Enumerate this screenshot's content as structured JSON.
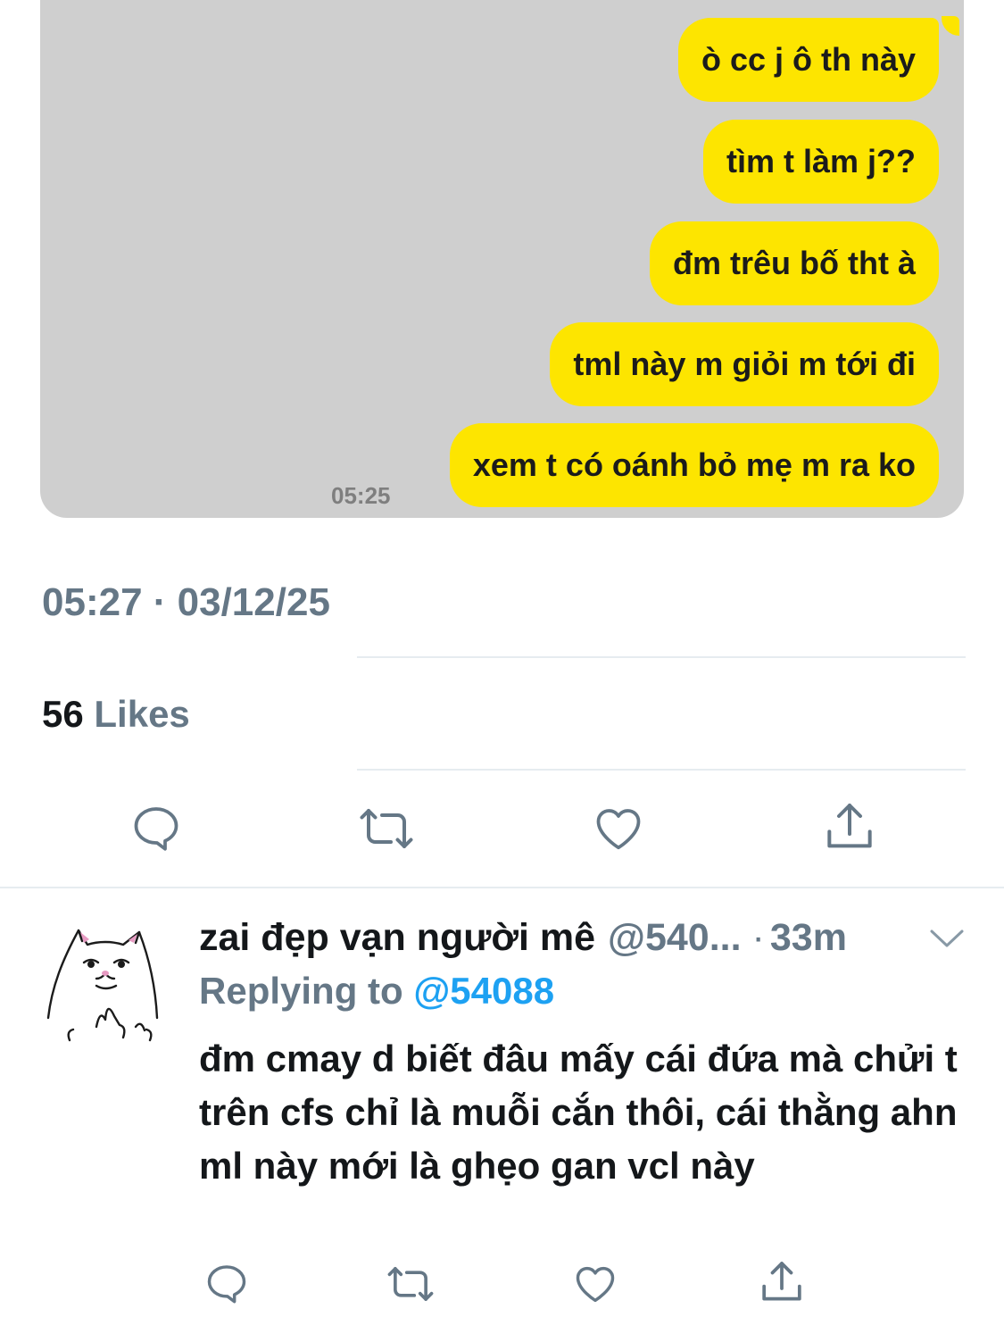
{
  "chat": {
    "bubbles": [
      "ò cc j ô th này",
      "tìm t làm j??",
      "đm trêu bố tht à",
      "tml này m giỏi m tới đi",
      "xem t có oánh bỏ mẹ m ra ko"
    ],
    "time": "05:25",
    "colors": {
      "background": "#cfcfcf",
      "bubble": "#fde500"
    }
  },
  "tweet": {
    "timestamp": "05:27 · 03/12/25",
    "likes_count": "56",
    "likes_label": "Likes",
    "actions": [
      "reply-icon",
      "retweet-icon",
      "like-icon",
      "share-icon"
    ]
  },
  "reply": {
    "display_name": "zai đẹp vạn người mê",
    "handle": "@540...",
    "dot": "·",
    "age": "33m",
    "replying_prefix": "Replying to",
    "replying_to": "@54088",
    "text": "đm cmay d biết đâu mấy cái đứa mà chửi t trên cfs chỉ là muỗi cắn thôi, cái thằng ahn ml này mới là ghẹo gan vcl này",
    "actions": [
      "reply-icon",
      "retweet-icon",
      "like-icon",
      "share-icon"
    ]
  },
  "colors": {
    "secondary_text": "#657786",
    "link": "#1da1f2",
    "divider": "#e6ecf0"
  }
}
